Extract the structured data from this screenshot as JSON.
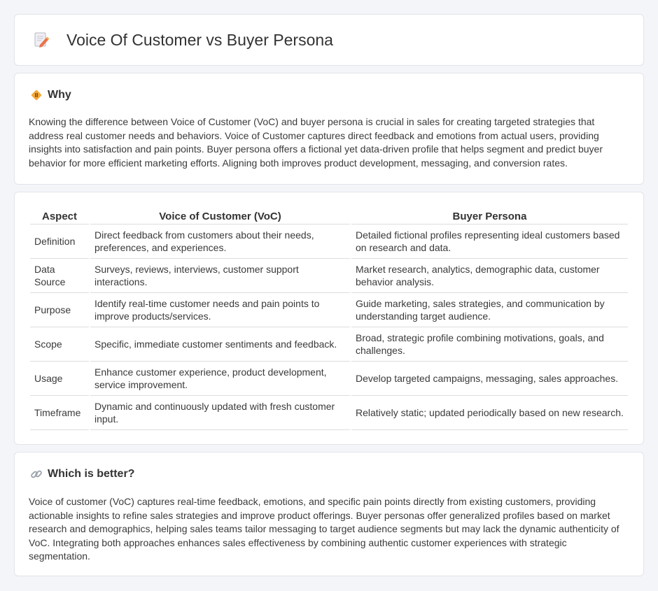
{
  "header": {
    "title": "Voice Of Customer vs Buyer Persona",
    "icon": "document-pencil-icon"
  },
  "why": {
    "heading": "Why",
    "icon": "diamond-sign-icon",
    "text": "Knowing the difference between Voice of Customer (VoC) and buyer persona is crucial in sales for creating targeted strategies that address real customer needs and behaviors. Voice of Customer captures direct feedback and emotions from actual users, providing insights into satisfaction and pain points. Buyer persona offers a fictional yet data-driven profile that helps segment and predict buyer behavior for more efficient marketing efforts. Aligning both improves product development, messaging, and conversion rates."
  },
  "table": {
    "headers": [
      "Aspect",
      "Voice of Customer (VoC)",
      "Buyer Persona"
    ],
    "rows": [
      [
        "Definition",
        "Direct feedback from customers about their needs, preferences, and experiences.",
        "Detailed fictional profiles representing ideal customers based on research and data."
      ],
      [
        "Data Source",
        "Surveys, reviews, interviews, customer support interactions.",
        "Market research, analytics, demographic data, customer behavior analysis."
      ],
      [
        "Purpose",
        "Identify real-time customer needs and pain points to improve products/services.",
        "Guide marketing, sales strategies, and communication by understanding target audience."
      ],
      [
        "Scope",
        "Specific, immediate customer sentiments and feedback.",
        "Broad, strategic profile combining motivations, goals, and challenges."
      ],
      [
        "Usage",
        "Enhance customer experience, product development, service improvement.",
        "Develop targeted campaigns, messaging, sales approaches."
      ],
      [
        "Timeframe",
        "Dynamic and continuously updated with fresh customer input.",
        "Relatively static; updated periodically based on new research."
      ]
    ]
  },
  "better": {
    "heading": "Which is better?",
    "icon": "link-icon",
    "text": "Voice of customer (VoC) captures real-time feedback, emotions, and specific pain points directly from existing customers, providing actionable insights to refine sales strategies and improve product offerings. Buyer personas offer generalized profiles based on market research and demographics, helping sales teams tailor messaging to target audience segments but may lack the dynamic authenticity of VoC. Integrating both approaches enhances sales effectiveness by combining authentic customer experiences with strategic segmentation."
  }
}
